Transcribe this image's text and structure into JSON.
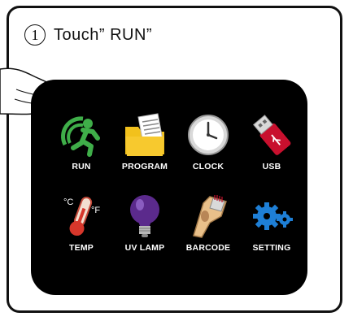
{
  "instruction": {
    "step_number": "1",
    "text": "Touch” RUN”"
  },
  "menu": {
    "items": [
      {
        "label": "RUN",
        "icon": "run-icon"
      },
      {
        "label": "PROGRAM",
        "icon": "program-folder-icon"
      },
      {
        "label": "CLOCK",
        "icon": "clock-icon"
      },
      {
        "label": "USB",
        "icon": "usb-icon"
      },
      {
        "label": "TEMP",
        "icon": "thermometer-icon"
      },
      {
        "label": "UV LAMP",
        "icon": "uv-lamp-icon"
      },
      {
        "label": "BARCODE",
        "icon": "barcode-scanner-icon"
      },
      {
        "label": "SETTING",
        "icon": "gears-icon"
      }
    ]
  },
  "colors": {
    "screen_bg": "#000000",
    "run_green": "#3fae49",
    "folder_yellow": "#f2c11c",
    "usb_red": "#c8102e",
    "uv_purple": "#5b2a8c",
    "gear_blue": "#1e7fd6"
  }
}
